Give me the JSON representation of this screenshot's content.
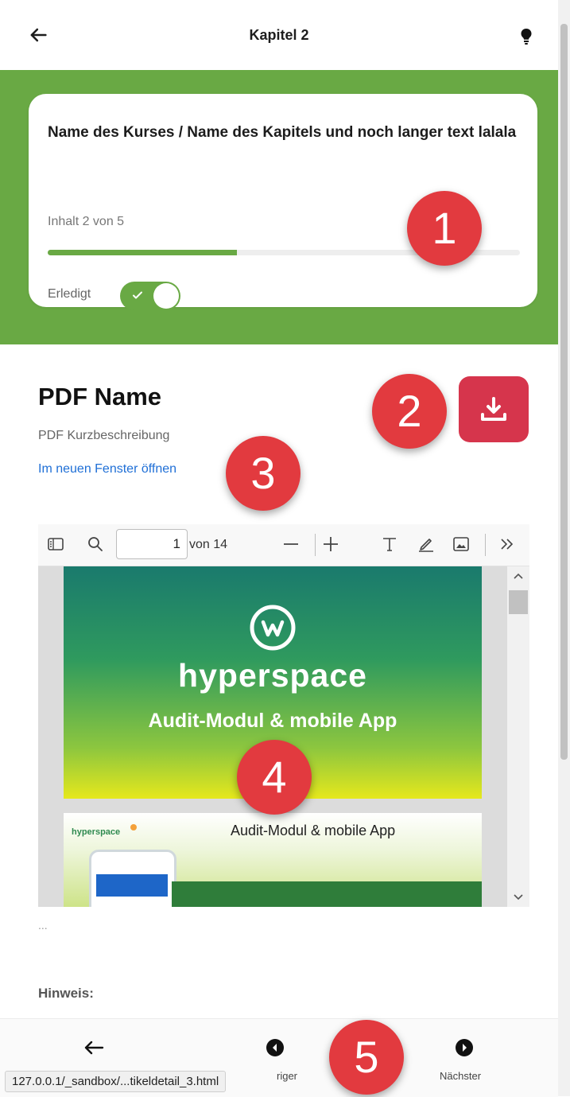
{
  "header": {
    "title": "Kapitel 2",
    "back_icon": "arrow-left-icon",
    "hint_icon": "lightbulb-icon"
  },
  "course": {
    "name": "Name des Kurses / Name des Kapitels und noch langer text lalala",
    "progress_text": "Inhalt 2 von 5",
    "progress_fraction": 0.4,
    "done_label": "Erledigt",
    "done": true
  },
  "pdf": {
    "title": "PDF Name",
    "description": "PDF Kurzbeschreibung",
    "open_link": "Im neuen Fenster öffnen",
    "download_icon": "download-icon"
  },
  "viewer": {
    "current_page": "1",
    "total": "von 14",
    "slide1_brand": "hyperspace",
    "slide1_subtitle": "Audit-Modul & mobile App",
    "slide2_brand": "hyperspace",
    "slide2_title": "Audit-Modul & mobile App"
  },
  "content": {
    "ellipsis": "...",
    "hint": "Hinweis:"
  },
  "bottom_nav": {
    "prev_label": "riger",
    "next_label": "Nächster"
  },
  "status_url": "127.0.0.1/_sandbox/...tikeldetail_3.html",
  "markers": [
    "1",
    "2",
    "3",
    "4",
    "5"
  ],
  "colors": {
    "green": "#69a944",
    "download_red": "#d6354c",
    "marker_red": "#e23a3f",
    "link_blue": "#1f6fd6"
  }
}
